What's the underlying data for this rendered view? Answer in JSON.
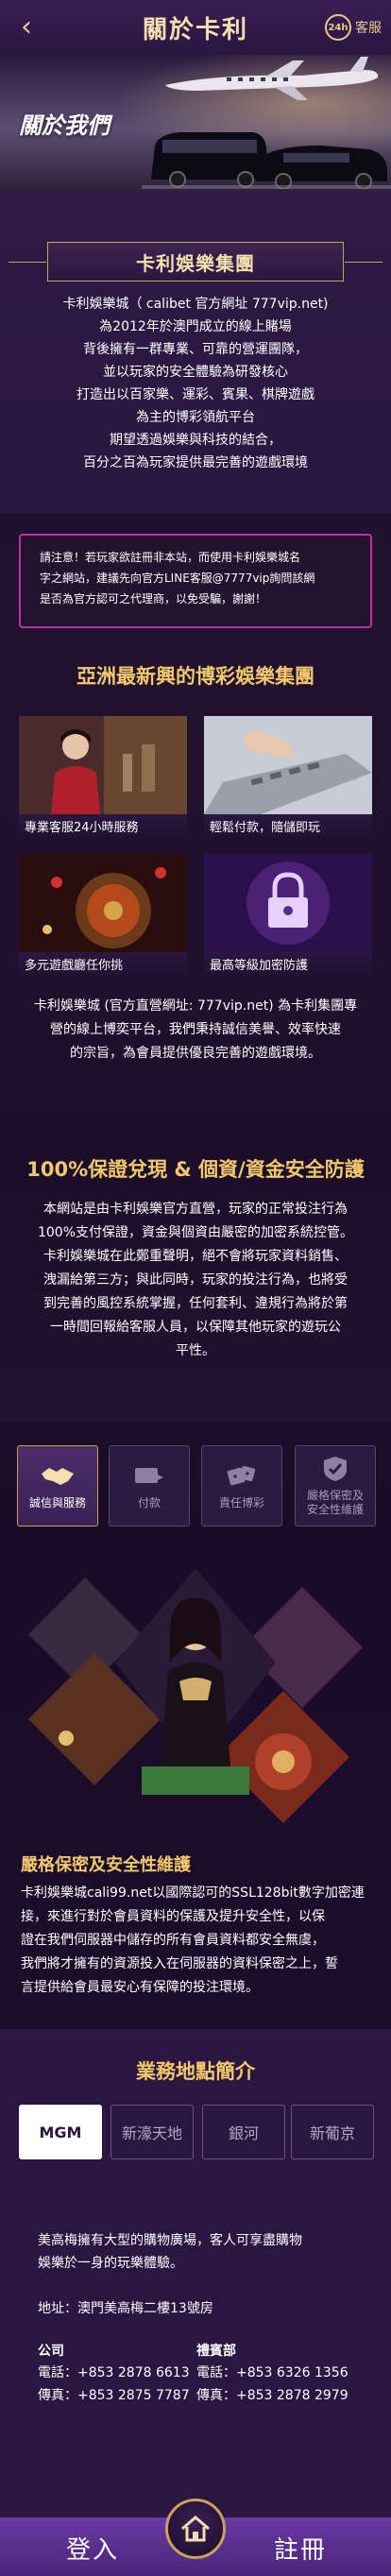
{
  "header": {
    "back_icon": "chevron-left-icon",
    "title": "關於卡利",
    "service_badge": "24h",
    "service_label": "客服"
  },
  "hero": {
    "title": "關於我們"
  },
  "intro": {
    "heading": "卡利娛樂集團",
    "lines": [
      "卡利娛樂城（ calibet 官方網址 777vip.net)",
      "為2012年於澳門成立的線上賭場",
      "背後擁有一群專業、可靠的營運團隊，",
      "並以玩家的安全體驗為研發核心",
      "打造出以百家樂、運彩、賓果、棋牌遊戲",
      "為主的博彩領航平台",
      "期望透過娛樂與科技的結合，",
      "百分之百為玩家提供最完善的遊戲環境"
    ]
  },
  "notice": {
    "lines": [
      "請注意！若玩家欲註冊非本站，而使用卡利娛樂城名",
      "字之網站，建議先向官方LINE客服@7777vip詢問該網",
      "是否為官方認可之代理商，以免受騙，謝謝！"
    ]
  },
  "asia": {
    "title": "亞洲最新興的博彩娛樂集團",
    "features": [
      {
        "label": "專業客服24小時服務"
      },
      {
        "label": "輕鬆付款，隨儲即玩"
      },
      {
        "label": "多元遊戲廳任你挑"
      },
      {
        "label": "最高等級加密防護"
      }
    ],
    "desc": [
      "卡利娛樂城 (官方直營網址: 777vip.net) 為卡利集團專",
      "營的線上博奕平台，我們秉持誠信美譽、效率快速",
      "的宗旨，為會員提供優良完善的遊戲環境。"
    ]
  },
  "security": {
    "title": "100%保證兌現 & 個資/資金安全防護",
    "lines": [
      "本網站是由卡利娛樂官方直營，玩家的正常投注行為",
      "100%支付保證，資金與個資由嚴密的加密系統控管。",
      "卡利娛樂城在此鄭重聲明，絕不會將玩家資料銷售、",
      "洩漏給第三方；與此同時，玩家的投注行為，也將受",
      "到完善的風控系統掌握，任何套利、違規行為將於第",
      "一時間回報給客服人員，以保障其他玩家的遊玩公",
      "平性。"
    ]
  },
  "tabs": [
    {
      "label": "誠信與服務",
      "icon": "handshake-icon",
      "active": true
    },
    {
      "label": "付款",
      "icon": "payment-icon",
      "active": false
    },
    {
      "label": "責任博彩",
      "icon": "dice-icon",
      "active": false
    },
    {
      "label": "嚴格保密及\n安全性維護",
      "icon": "shield-check-icon",
      "active": false
    }
  ],
  "security2": {
    "title": "嚴格保密及安全性維護",
    "lines": [
      "卡利娛樂城cali99.net以國際認可的SSL128bit數字加密連",
      "接，來進行對於會員資料的保護及提升安全性，以保",
      "證在我們伺服器中儲存的所有會員資料都安全無虞，",
      "我們將才擁有的資源投入在伺服器的資料保密之上，誓",
      "言提供給會員最安心有保障的投注環境。"
    ]
  },
  "locations": {
    "title": "業務地點簡介",
    "tabs": [
      {
        "label": "MGM",
        "active": true
      },
      {
        "label": "新濠天地",
        "active": false
      },
      {
        "label": "銀河",
        "active": false
      },
      {
        "label": "新葡京",
        "active": false
      }
    ],
    "desc": [
      "美高梅擁有大型的購物廣場，客人可享盡購物",
      "娛樂於一身的玩樂體驗。"
    ],
    "address": "地址：澳門美高梅二樓13號房",
    "company": {
      "head": "公司",
      "phone": "電話：+853 2878 6613",
      "fax": "傳真：+853 2875 7787"
    },
    "vip": {
      "head": "禮賓部",
      "phone": "電話：+853 6326 1356",
      "fax": "傳真：+853 2878 2979"
    }
  },
  "bottom": {
    "login": "登入",
    "register": "註冊",
    "home_icon": "home-icon"
  }
}
